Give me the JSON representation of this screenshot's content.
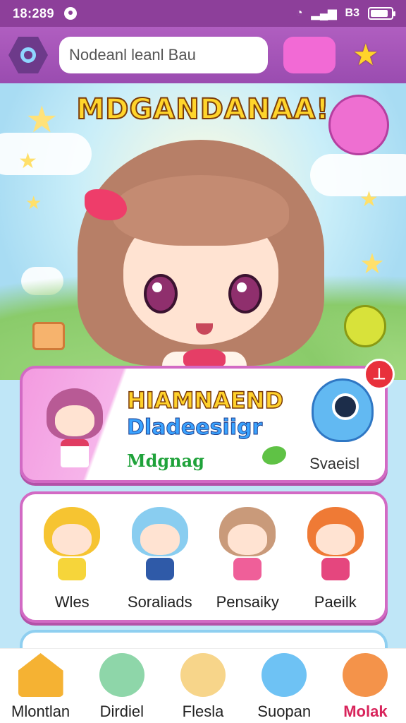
{
  "status_bar": {
    "time": "18:289",
    "signal_text": "B3",
    "battery_level": 0.85
  },
  "top_bar": {
    "search_value": "Nodeanl leanl Bau"
  },
  "hero": {
    "title": "MDGANDANAA!"
  },
  "feature_card": {
    "title": "HIAMNAEND",
    "subtitle": "Dladeesiigr",
    "tag": "Mdgnag",
    "link": "Svaeisl",
    "close_symbol": "⊥"
  },
  "characters": [
    {
      "label": "Wles",
      "hair": "#f6c431",
      "outfit": "#f6d53a"
    },
    {
      "label": "Soraliads",
      "hair": "#89cdf0",
      "outfit": "#2f5aa8"
    },
    {
      "label": "Pensaiky",
      "hair": "#c99a7a",
      "outfit": "#ef5f99"
    },
    {
      "label": "Paeilk",
      "hair": "#ef7a35",
      "outfit": "#e5467e"
    }
  ],
  "bottom_nav": [
    {
      "label": "Mlontlan",
      "color": "#f5b233"
    },
    {
      "label": "Dirdiel",
      "color": "#8ed6a9"
    },
    {
      "label": "Flesla",
      "color": "#f7d58a"
    },
    {
      "label": "Suopan",
      "color": "#6ec2f4"
    },
    {
      "label": "Molak",
      "color": "#f4934a",
      "active": true
    }
  ],
  "colors": {
    "accent": "#b05ec0",
    "card_border": "#d26ac4",
    "active": "#d8245b"
  }
}
